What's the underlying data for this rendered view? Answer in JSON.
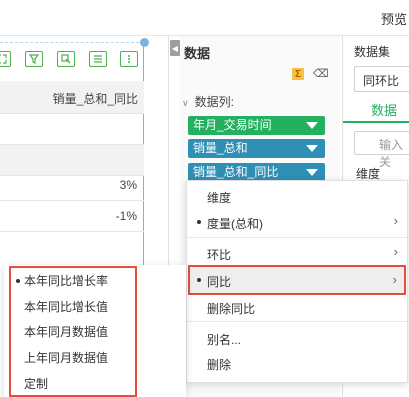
{
  "header": {
    "preview_label": "预览"
  },
  "table": {
    "column_header": "销量_总和_同比",
    "rows": [
      {
        "value": ""
      },
      {
        "value": ""
      },
      {
        "value": "3%"
      },
      {
        "value": "-1%"
      },
      {
        "value": ""
      }
    ],
    "toolbar_icons": [
      "expand-icon",
      "filter-icon",
      "select-icon",
      "list-icon",
      "more-icon"
    ]
  },
  "data_panel": {
    "title": "数据",
    "columns_label": "数据列:",
    "fields": [
      {
        "label": "年月_交易时间",
        "color": "#23b15f"
      },
      {
        "label": "销量_总和",
        "color": "#2f8fb5"
      },
      {
        "label": "销量_总和_同比",
        "color": "#2f8fb5"
      }
    ]
  },
  "dataset_panel": {
    "title": "数据集",
    "selected": "同环比",
    "tab": "数据",
    "search_placeholder": "输入关",
    "dimension_label": "维度"
  },
  "context_menu": {
    "items": [
      {
        "label": "维度",
        "dot": false,
        "arrow": false
      },
      {
        "label": "度量(总和)",
        "dot": true,
        "arrow": true
      },
      {
        "label": "环比",
        "dot": false,
        "arrow": true
      },
      {
        "label": "同比",
        "dot": true,
        "arrow": true,
        "active": true
      },
      {
        "label": "删除同比",
        "dot": false,
        "arrow": false
      },
      {
        "label": "别名...",
        "dot": false,
        "arrow": false
      },
      {
        "label": "删除",
        "dot": false,
        "arrow": false
      }
    ],
    "highlight_color": "#e74c3c"
  },
  "submenu": {
    "items": [
      {
        "label": "本年同比增长率",
        "selected": true
      },
      {
        "label": "本年同比增长值",
        "selected": false
      },
      {
        "label": "本年同月数据值",
        "selected": false
      },
      {
        "label": "上年同月数据值",
        "selected": false
      },
      {
        "label": "定制",
        "selected": false
      }
    ]
  }
}
